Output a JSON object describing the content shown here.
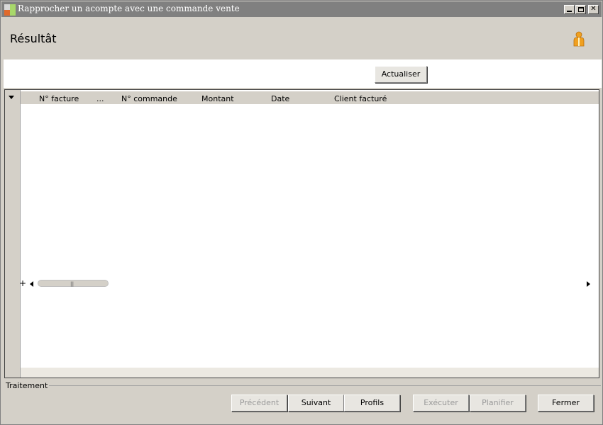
{
  "window": {
    "title": "Rapprocher un acompte avec une commande vente"
  },
  "header": {
    "title": "Résultât",
    "user_icon": "user-icon"
  },
  "toolbar": {
    "refresh_label": "Actualiser"
  },
  "grid": {
    "columns": [
      "N° facture",
      "...",
      "N° commande",
      "Montant",
      "Date",
      "Client facturé"
    ],
    "rows": [],
    "scroll_plus": "+"
  },
  "treatment": {
    "label": "Traitement",
    "buttons": {
      "previous": "Précédent",
      "next": "Suivant",
      "profiles": "Profils",
      "execute": "Exécuter",
      "plan": "Planifier",
      "close": "Fermer"
    }
  },
  "colors": {
    "titlebar": "#808080",
    "window_bg": "#d4d0c8",
    "accent_icon": "#f0a020"
  }
}
